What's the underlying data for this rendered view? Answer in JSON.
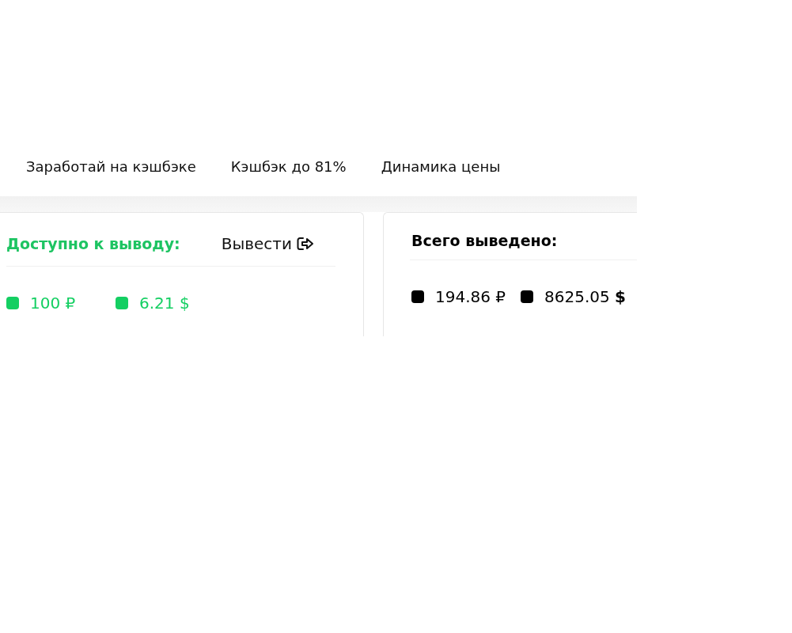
{
  "nav": [
    "Заработай на кэшбэке",
    "Кэшбэк до 81%",
    "Динамика цены"
  ],
  "cards": [
    {
      "kind": "available",
      "title": "Доступно к выводу:",
      "action": "Вывести",
      "amounts": [
        {
          "text": "100 ₽",
          "color": "#14cf62"
        },
        {
          "text": "6.21 $",
          "color": "#14cf62"
        }
      ]
    },
    {
      "kind": "total",
      "title": "Всего выведено:",
      "amounts": [
        {
          "text": "194.86 ₽",
          "color": "#000000"
        },
        {
          "text": "8625.05 **$**",
          "color": "#000000"
        }
      ]
    }
  ]
}
